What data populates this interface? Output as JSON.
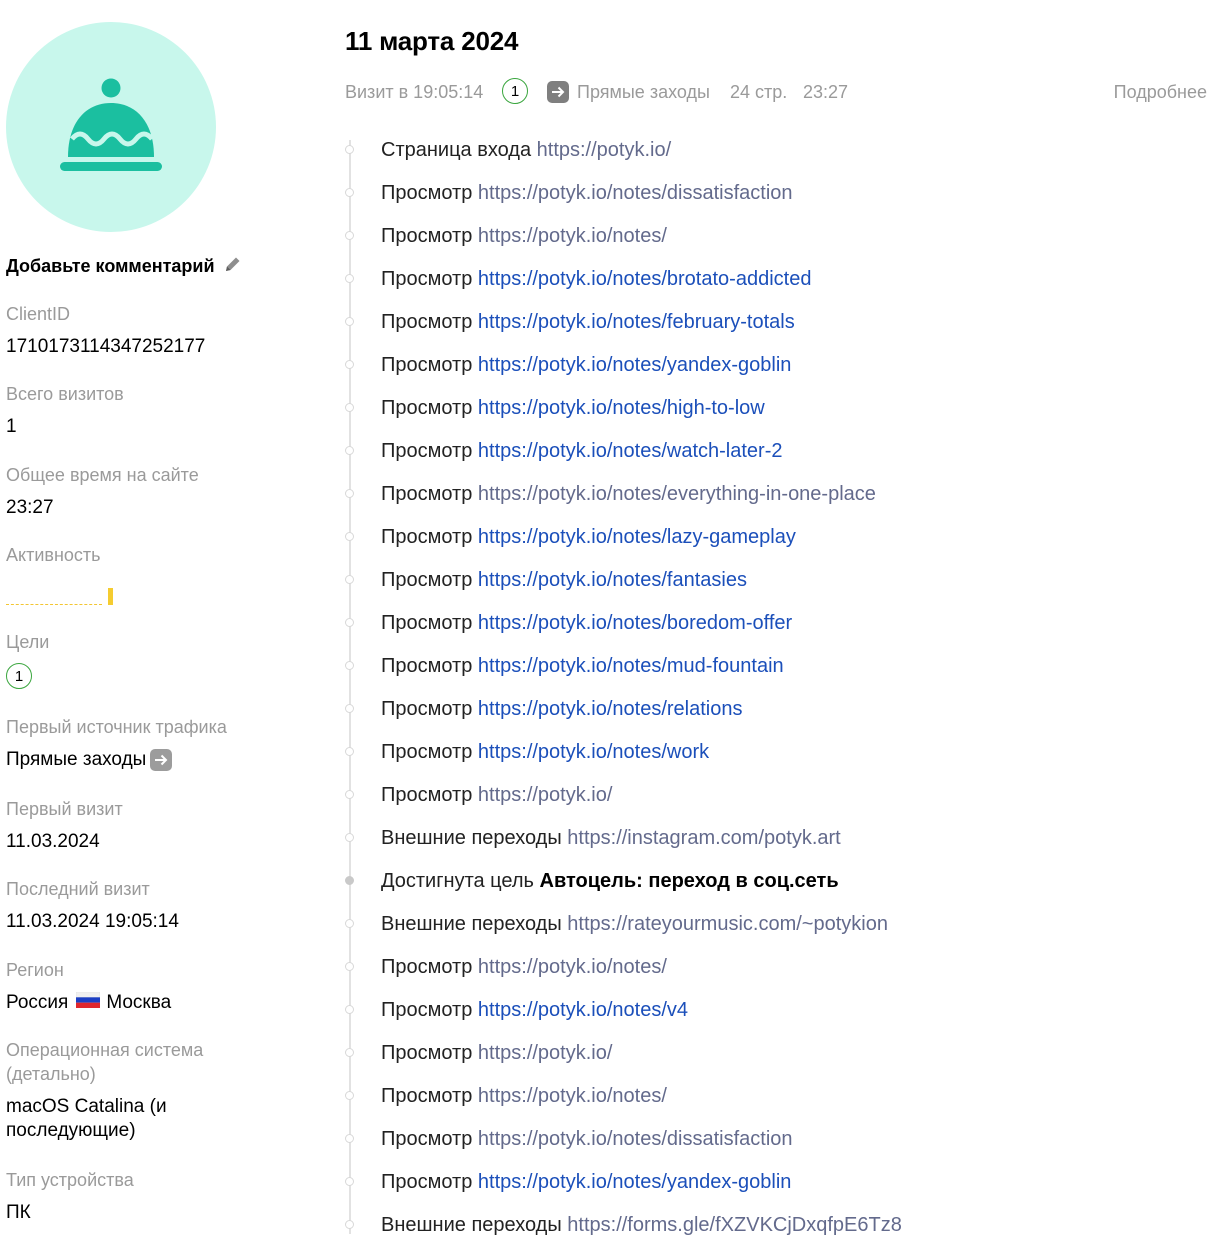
{
  "profile": {
    "comment_label": "Добавьте комментарий",
    "fields": {
      "client_id": {
        "label": "ClientID",
        "value": "1710173114347252177"
      },
      "total_visits": {
        "label": "Всего визитов",
        "value": "1"
      },
      "total_time": {
        "label": "Общее время на сайте",
        "value": "23:27"
      },
      "activity": {
        "label": "Активность"
      },
      "goals": {
        "label": "Цели",
        "value": "1"
      },
      "first_source": {
        "label": "Первый источник трафика",
        "value": "Прямые заходы"
      },
      "first_visit": {
        "label": "Первый визит",
        "value": "11.03.2024"
      },
      "last_visit": {
        "label": "Последний визит",
        "value": "11.03.2024 19:05:14"
      },
      "region": {
        "label": "Регион",
        "country": "Россия",
        "city": "Москва"
      },
      "os": {
        "label_line1": "Операционная система",
        "label_line2": "(детально)",
        "value_line1": "macOS Catalina (и",
        "value_line2": "последующие)"
      },
      "device": {
        "label": "Тип устройства",
        "value": "ПК"
      }
    }
  },
  "visit": {
    "date": "11 марта 2024",
    "time": "Визит в 19:05:14",
    "goals_count": "1",
    "source": "Прямые заходы",
    "pages": "24 стр.",
    "duration": "23:27",
    "more": "Подробнее"
  },
  "colors": {
    "link": "#1b4fba",
    "visited_link": "#636a8c",
    "goal_badge": "#3aa63e",
    "avatar_bg": "#c8f7ec",
    "avatar_icon": "#1bbfa0",
    "activity": "#f5cc30"
  },
  "events": [
    {
      "type": "Страница входа",
      "url": "https://potyk.io/",
      "visited": true
    },
    {
      "type": "Просмотр",
      "url": "https://potyk.io/notes/dissatisfaction",
      "visited": true
    },
    {
      "type": "Просмотр",
      "url": "https://potyk.io/notes/",
      "visited": true
    },
    {
      "type": "Просмотр",
      "url": "https://potyk.io/notes/brotato-addicted",
      "visited": false
    },
    {
      "type": "Просмотр",
      "url": "https://potyk.io/notes/february-totals",
      "visited": false
    },
    {
      "type": "Просмотр",
      "url": "https://potyk.io/notes/yandex-goblin",
      "visited": false
    },
    {
      "type": "Просмотр",
      "url": "https://potyk.io/notes/high-to-low",
      "visited": false
    },
    {
      "type": "Просмотр",
      "url": "https://potyk.io/notes/watch-later-2",
      "visited": false
    },
    {
      "type": "Просмотр",
      "url": "https://potyk.io/notes/everything-in-one-place",
      "visited": true
    },
    {
      "type": "Просмотр",
      "url": "https://potyk.io/notes/lazy-gameplay",
      "visited": false
    },
    {
      "type": "Просмотр",
      "url": "https://potyk.io/notes/fantasies",
      "visited": false
    },
    {
      "type": "Просмотр",
      "url": "https://potyk.io/notes/boredom-offer",
      "visited": false
    },
    {
      "type": "Просмотр",
      "url": "https://potyk.io/notes/mud-fountain",
      "visited": false
    },
    {
      "type": "Просмотр",
      "url": "https://potyk.io/notes/relations",
      "visited": false
    },
    {
      "type": "Просмотр",
      "url": "https://potyk.io/notes/work",
      "visited": false
    },
    {
      "type": "Просмотр",
      "url": "https://potyk.io/",
      "visited": true
    },
    {
      "type": "Внешние переходы",
      "url": "https://instagram.com/potyk.art",
      "visited": true
    },
    {
      "type": "Достигнута цель",
      "goal": "Автоцель: переход в соц.сеть"
    },
    {
      "type": "Внешние переходы",
      "url": "https://rateyourmusic.com/~potykion",
      "visited": true
    },
    {
      "type": "Просмотр",
      "url": "https://potyk.io/notes/",
      "visited": true
    },
    {
      "type": "Просмотр",
      "url": "https://potyk.io/notes/v4",
      "visited": false
    },
    {
      "type": "Просмотр",
      "url": "https://potyk.io/",
      "visited": true
    },
    {
      "type": "Просмотр",
      "url": "https://potyk.io/notes/",
      "visited": true
    },
    {
      "type": "Просмотр",
      "url": "https://potyk.io/notes/dissatisfaction",
      "visited": true
    },
    {
      "type": "Просмотр",
      "url": "https://potyk.io/notes/yandex-goblin",
      "visited": false
    },
    {
      "type": "Внешние переходы",
      "url": "https://forms.gle/fXZVKCjDxqfpE6Tz8",
      "visited": true
    }
  ]
}
